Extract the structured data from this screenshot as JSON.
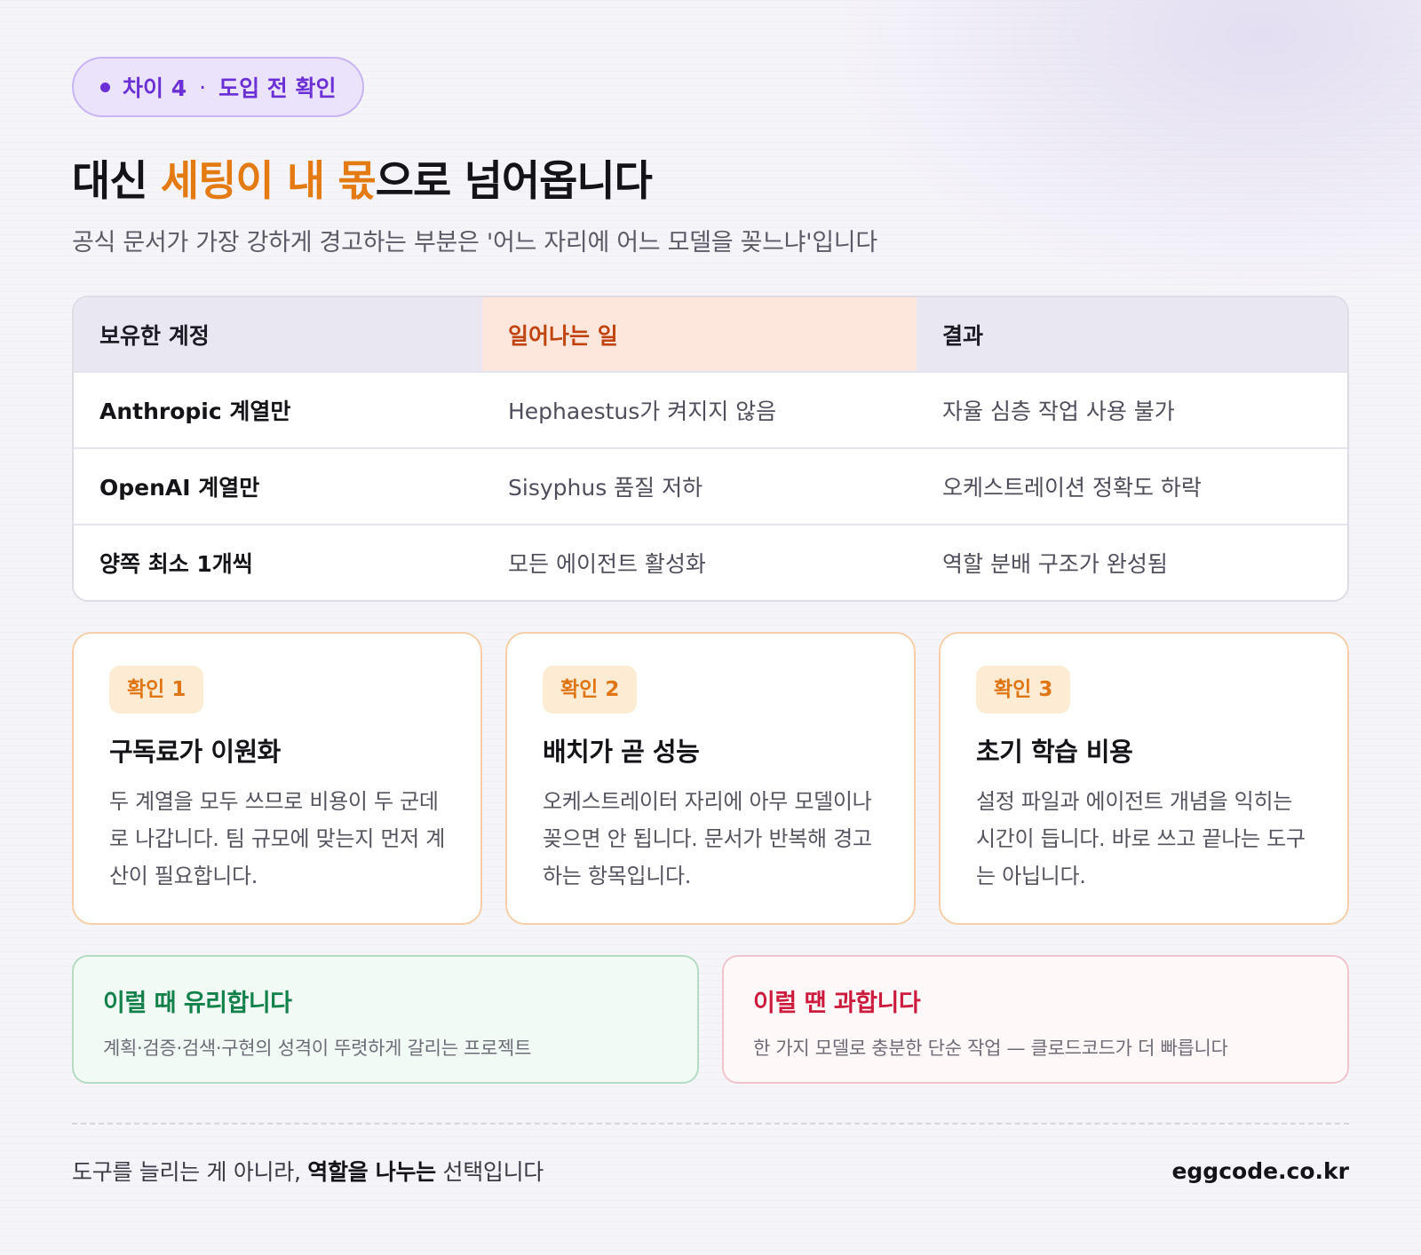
{
  "pill": {
    "label": "차이 4",
    "sep": "·",
    "sub": "도입 전 확인"
  },
  "headline": {
    "part1": "대신 ",
    "highlight": "세팅이 내 몫",
    "part2": "으로 넘어옵니다"
  },
  "subtitle": "공식 문서가 가장 강하게 경고하는 부분은 '어느 자리에 어느 모델을 꽂느냐'입니다",
  "table": {
    "headers": [
      "보유한 계정",
      "일어나는 일",
      "결과"
    ],
    "rows": [
      [
        "Anthropic 계열만",
        "Hephaestus가 켜지지 않음",
        "자율 심층 작업 사용 불가"
      ],
      [
        "OpenAI 계열만",
        "Sisyphus 품질 저하",
        "오케스트레이션 정확도 하락"
      ],
      [
        "양쪽 최소 1개씩",
        "모든 에이전트 활성화",
        "역할 분배 구조가 완성됨"
      ]
    ]
  },
  "cards": [
    {
      "badge": "확인 1",
      "title": "구독료가 이원화",
      "body": "두 계열을 모두 쓰므로 비용이 두 군데로 나갑니다. 팀 규모에 맞는지 먼저 계산이 필요합니다."
    },
    {
      "badge": "확인 2",
      "title": "배치가 곧 성능",
      "body": "오케스트레이터 자리에 아무 모델이나 꽂으면 안 됩니다. 문서가 반복해 경고하는 항목입니다."
    },
    {
      "badge": "확인 3",
      "title": "초기 학습 비용",
      "body": "설정 파일과 에이전트 개념을 익히는 시간이 듭니다. 바로 쓰고 끝나는 도구는 아닙니다."
    }
  ],
  "good": {
    "title": "이럴 때 유리합니다",
    "body": "계획·검증·검색·구현의 성격이 뚜렷하게 갈리는 프로젝트"
  },
  "bad": {
    "title": "이럴 땐 과합니다",
    "body": "한 가지 모델로 충분한 단순 작업 — 클로드코드가 더 빠릅니다"
  },
  "footer": {
    "pre": "도구를 늘리는 게 아니라, ",
    "bold": "역할을 나누는",
    "post": " 선택입니다",
    "site": "eggcode.co.kr"
  },
  "colors": {
    "accent_purple": "#6b2fd6",
    "accent_orange": "#e37a12",
    "good_green": "#13814a",
    "bad_red": "#cc1b3c"
  }
}
